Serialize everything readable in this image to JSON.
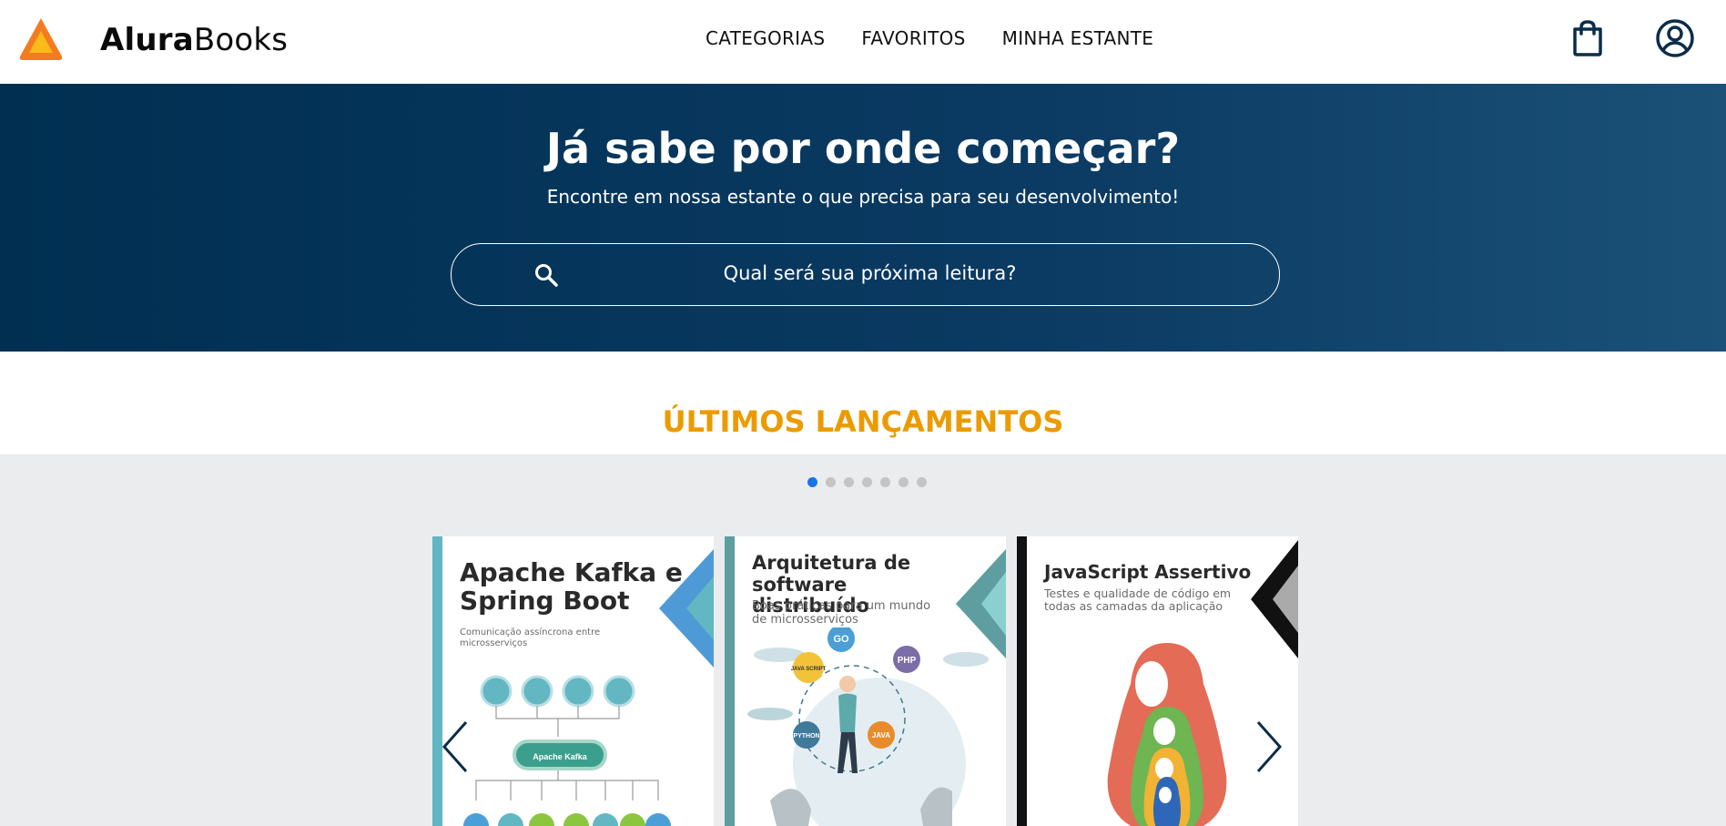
{
  "header": {
    "logo_bold": "Alura",
    "logo_light": "Books",
    "nav": [
      {
        "label": "CATEGORIAS"
      },
      {
        "label": "FAVORITOS"
      },
      {
        "label": "MINHA ESTANTE"
      }
    ],
    "icons": [
      "shopping-bag-icon",
      "user-account-icon"
    ]
  },
  "hero": {
    "title": "Já sabe por onde começar?",
    "subtitle": "Encontre em nossa estante o que precisa para seu desenvolvimento!",
    "search": {
      "placeholder": "Qual será sua próxima leitura?",
      "icon": "search-icon"
    }
  },
  "releases": {
    "title": "ÚLTIMOS LANÇAMENTOS",
    "dots_total": 7,
    "dots_active": 1,
    "books": [
      {
        "title": "Apache Kafka e Spring Boot",
        "subtitle": "Comunicação assíncrona entre microsserviços",
        "diagram_label": "Apache Kafka",
        "accent": "#4e9ad6",
        "spine": "#62b7c3"
      },
      {
        "title": "Arquitetura de software distribuído",
        "subtitle": "Boas práticas para um mundo de microsserviços",
        "bubbles": [
          "GO",
          "PHP",
          "JAVA SCRIPT",
          "PYTHON",
          "JAVA"
        ],
        "accent": "#5e9ea1",
        "spine": "#5e9ea1"
      },
      {
        "title": "JavaScript Assertivo",
        "subtitle": "Testes e qualidade de código em todas as camadas da aplicação",
        "accent": "#111111",
        "spine": "#111111"
      }
    ]
  },
  "colors": {
    "hero_dark": "#002f52",
    "accent_orange": "#eb9b00",
    "dot_active": "#1875e8",
    "carousel_bg": "#ebecee"
  }
}
